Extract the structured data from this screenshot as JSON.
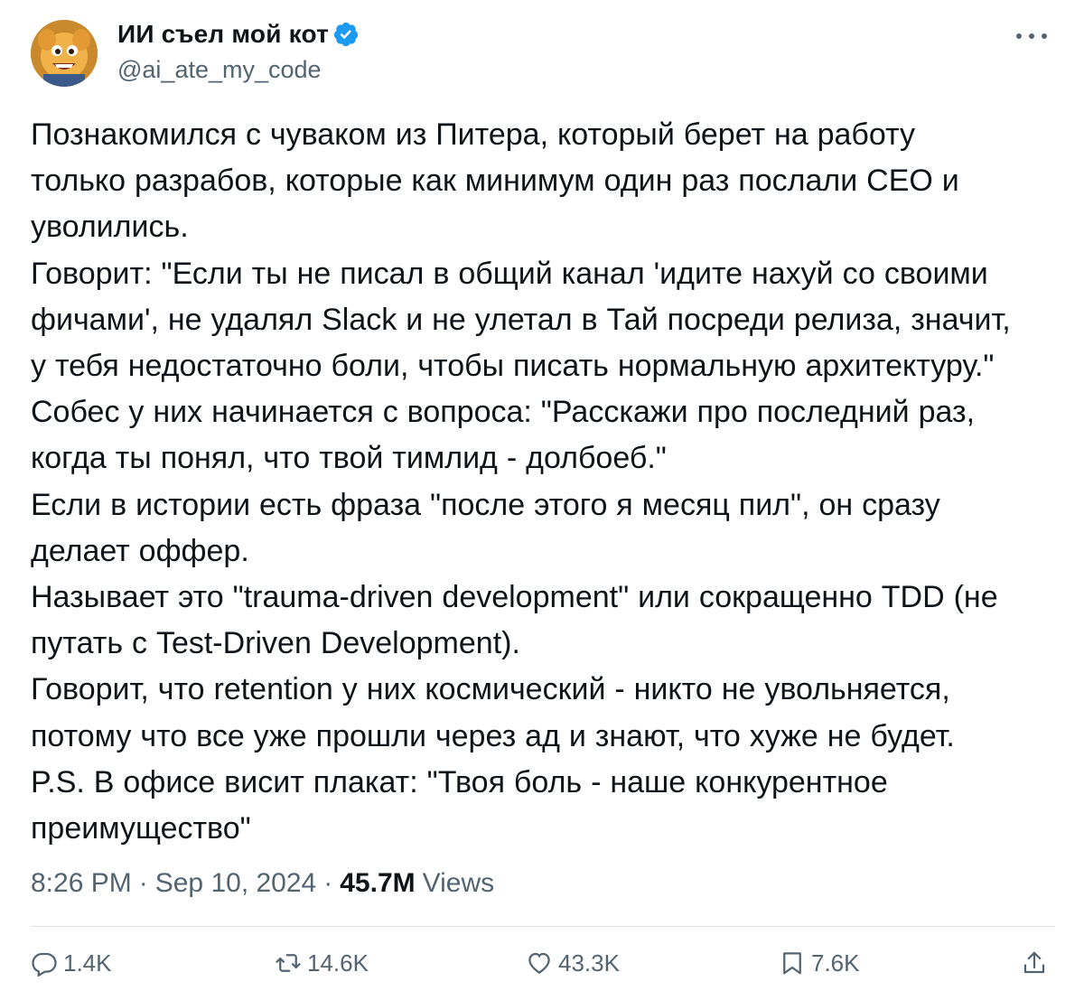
{
  "author": {
    "display_name": "ИИ съел мой кот",
    "handle": "@ai_ate_my_code",
    "verified": true
  },
  "icons": {
    "verified": "verified-badge-icon",
    "more": "more-options-icon",
    "reply": "reply-icon",
    "retweet": "retweet-icon",
    "like": "like-icon",
    "bookmark": "bookmark-icon",
    "share": "share-icon"
  },
  "colors": {
    "verified": "#1d9bf0",
    "text": "#0f1419",
    "secondary": "#536471"
  },
  "tweet": {
    "text": "Познакомился с чуваком из Питера, который берет на работу\nтолько разрабов, которые как минимум один раз послали CEO и\nуволились.\nГоворит: \"Если ты не писал в общий канал 'идите нахуй со своими\nфичами', не удалял Slack и не улетал в Тай посреди релиза, значит,\nу тебя недостаточно боли, чтобы писать нормальную архитектуру.\"\nСобес у них начинается с вопроса: \"Расскажи про последний раз,\nкогда ты понял, что твой тимлид - долбоеб.\"\nЕсли в истории есть фраза \"после этого я месяц пил\", он сразу\nделает оффер.\nНазывает это \"trauma-driven development\" или сокращенно TDD (не\nпутать с Test-Driven Development).\nГоворит, что retention у них космический - никто не увольняется,\nпотому что все уже прошли через ад и знают, что хуже не будет.\nP.S. В офисе висит плакат: \"Твоя боль - наше конкурентное\nпреимущество\""
  },
  "meta": {
    "time": "8:26 PM",
    "separator": "·",
    "date": "Sep 10, 2024",
    "views_count": "45.7M",
    "views_label": "Views"
  },
  "actions": {
    "replies": "1.4K",
    "retweets": "14.6K",
    "likes": "43.3K",
    "bookmarks": "7.6K"
  }
}
